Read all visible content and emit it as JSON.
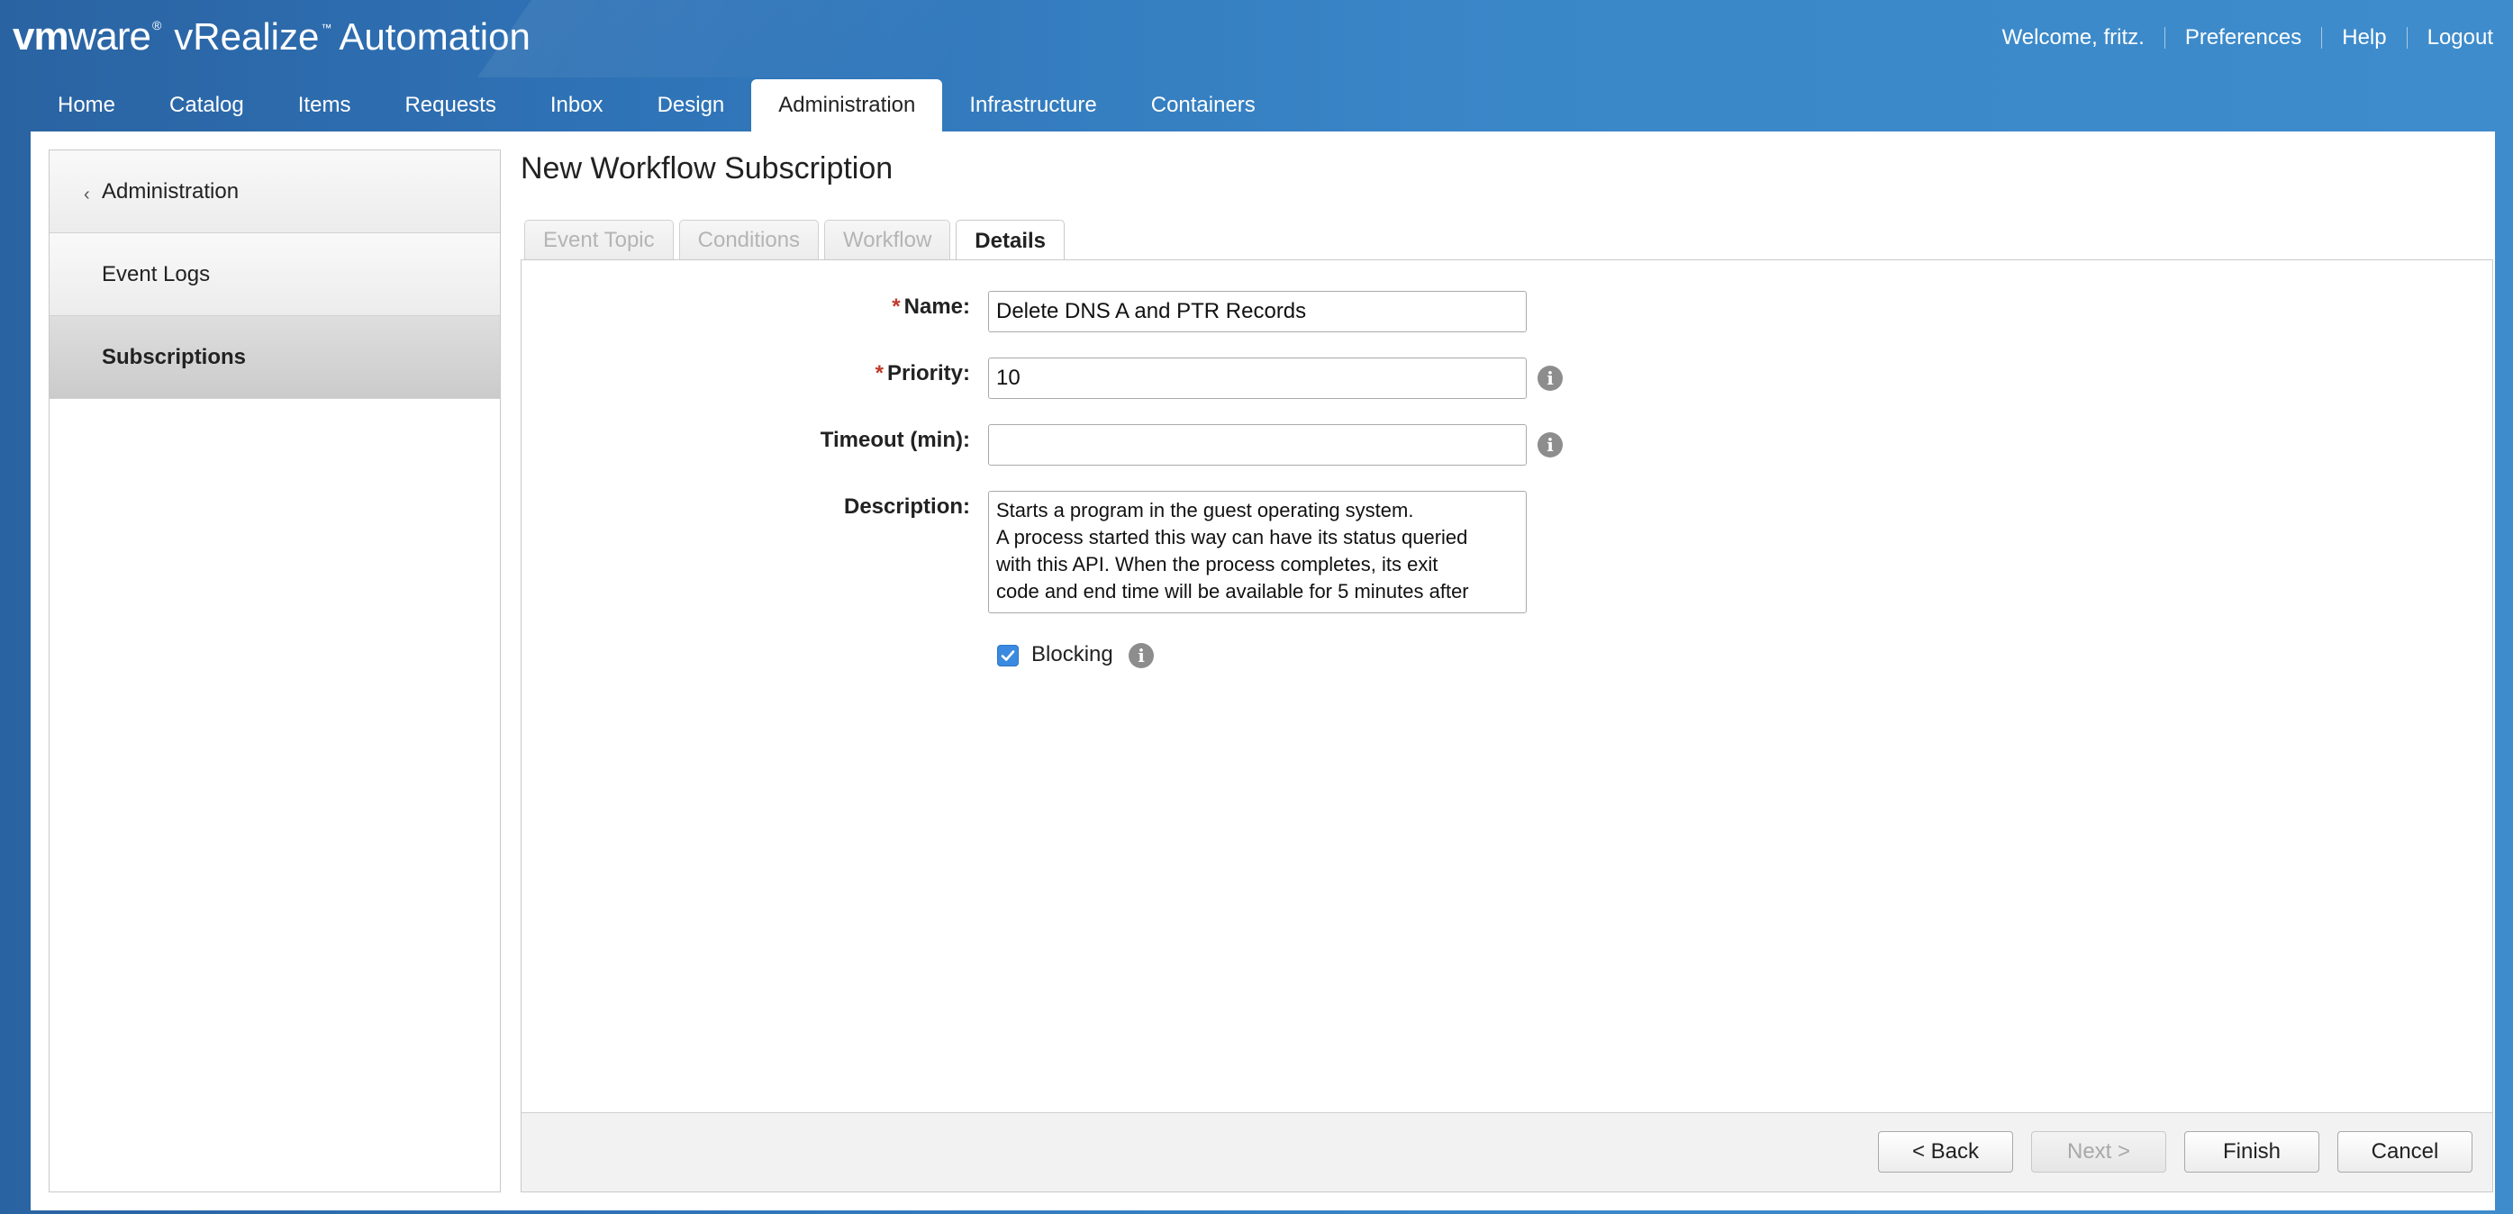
{
  "brand": {
    "vm": "vm",
    "ware": "ware",
    "reg": "®",
    "product": "vRealize",
    "tm": "™",
    "product2": "Automation"
  },
  "user_links": {
    "welcome": "Welcome, fritz.",
    "preferences": "Preferences",
    "help": "Help",
    "logout": "Logout"
  },
  "nav": {
    "tabs": [
      "Home",
      "Catalog",
      "Items",
      "Requests",
      "Inbox",
      "Design",
      "Administration",
      "Infrastructure",
      "Containers"
    ],
    "active": "Administration"
  },
  "sidebar": {
    "items": [
      {
        "label": "Administration",
        "type": "back"
      },
      {
        "label": "Event Logs"
      },
      {
        "label": "Subscriptions",
        "active": true
      }
    ]
  },
  "page": {
    "title": "New Workflow Subscription"
  },
  "wizard": {
    "tabs": [
      "Event Topic",
      "Conditions",
      "Workflow",
      "Details"
    ],
    "active": "Details"
  },
  "form": {
    "name_label": "Name:",
    "name_value": "Delete DNS A and PTR Records",
    "priority_label": "Priority:",
    "priority_value": "10",
    "timeout_label": "Timeout (min):",
    "timeout_value": "",
    "description_label": "Description:",
    "description_value": "Starts a program in the guest operating system.\nA process started this way can have its status queried\nwith this API. When the process completes, its exit\ncode and end time will be available for 5 minutes after",
    "required_marker": "*",
    "info_glyph": "i",
    "blocking_label": "Blocking",
    "blocking_checked": true
  },
  "footer": {
    "back": "< Back",
    "next": "Next >",
    "finish": "Finish",
    "cancel": "Cancel"
  },
  "colors": {
    "header_blue": "#2f73b7",
    "checkbox_blue": "#3a8ae0",
    "required_red": "#c0392b"
  }
}
